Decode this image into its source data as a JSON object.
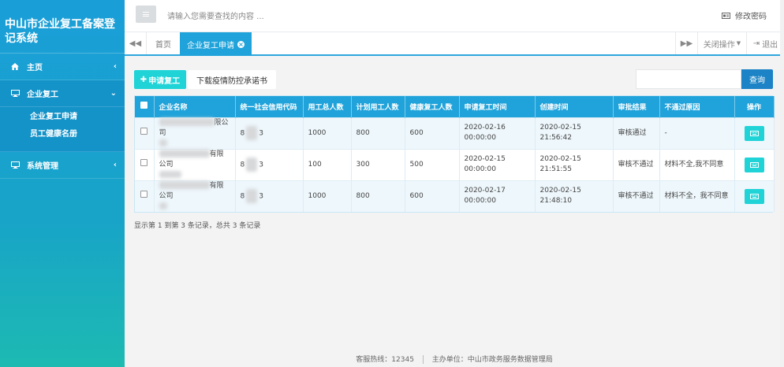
{
  "sidebar": {
    "brand": "中山市企业复工备案登记系统",
    "items": [
      {
        "label": "主页",
        "icon": "home-icon",
        "arrow": "‹"
      },
      {
        "label": "企业复工",
        "icon": "desktop-icon",
        "arrow": "⌄"
      },
      {
        "label": "系统管理",
        "icon": "desktop-icon",
        "arrow": "‹"
      }
    ],
    "sub_items": [
      "企业复工申请",
      "员工健康名册"
    ]
  },
  "topbar": {
    "search_placeholder": "请输入您需要查找的内容 ...",
    "change_password": "修改密码"
  },
  "tabs": {
    "home": "首页",
    "active": "企业复工申请",
    "close_ops": "关闭操作",
    "logout": "退出"
  },
  "toolbar": {
    "apply_label": "申请复工",
    "download_label": "下载疫情防控承诺书",
    "query_label": "查询"
  },
  "table": {
    "headers": [
      "企业名称",
      "统一社会信用代码",
      "用工总人数",
      "计划用工人数",
      "健康复工人数",
      "申请复工时间",
      "创建时间",
      "审批结果",
      "不通过原因",
      "操作"
    ],
    "rows": [
      {
        "name": "限公司",
        "code_a": "8",
        "code_b": "3",
        "total": "1000",
        "planned": "800",
        "healthy": "600",
        "apply_time": "2020-02-16 00:00:00",
        "created": "2020-02-15 21:56:42",
        "result": "审核通过",
        "reason": "-"
      },
      {
        "name": "有限公司",
        "code_a": "8",
        "code_b": "3",
        "total": "100",
        "planned": "300",
        "healthy": "500",
        "apply_time": "2020-02-15 00:00:00",
        "created": "2020-02-15 21:51:55",
        "result": "审核不通过",
        "reason": "材料不全,我不同意"
      },
      {
        "name": "有限公司",
        "code_a": "8",
        "code_b": "3",
        "total": "1000",
        "planned": "800",
        "healthy": "600",
        "apply_time": "2020-02-17 00:00:00",
        "created": "2020-02-15 21:48:10",
        "result": "审核不通过",
        "reason": "材料不全，我不同意"
      }
    ]
  },
  "pager": {
    "summary": "显示第 1 到第 3 条记录，总共 3 条记录"
  },
  "footer": {
    "hotline": "客服热线：12345",
    "organizer": "主办单位：中山市政务服务数据管理局"
  },
  "colors": {
    "accent": "#20a3da",
    "cyan": "#1fd3d7",
    "query": "#1c84c6"
  }
}
